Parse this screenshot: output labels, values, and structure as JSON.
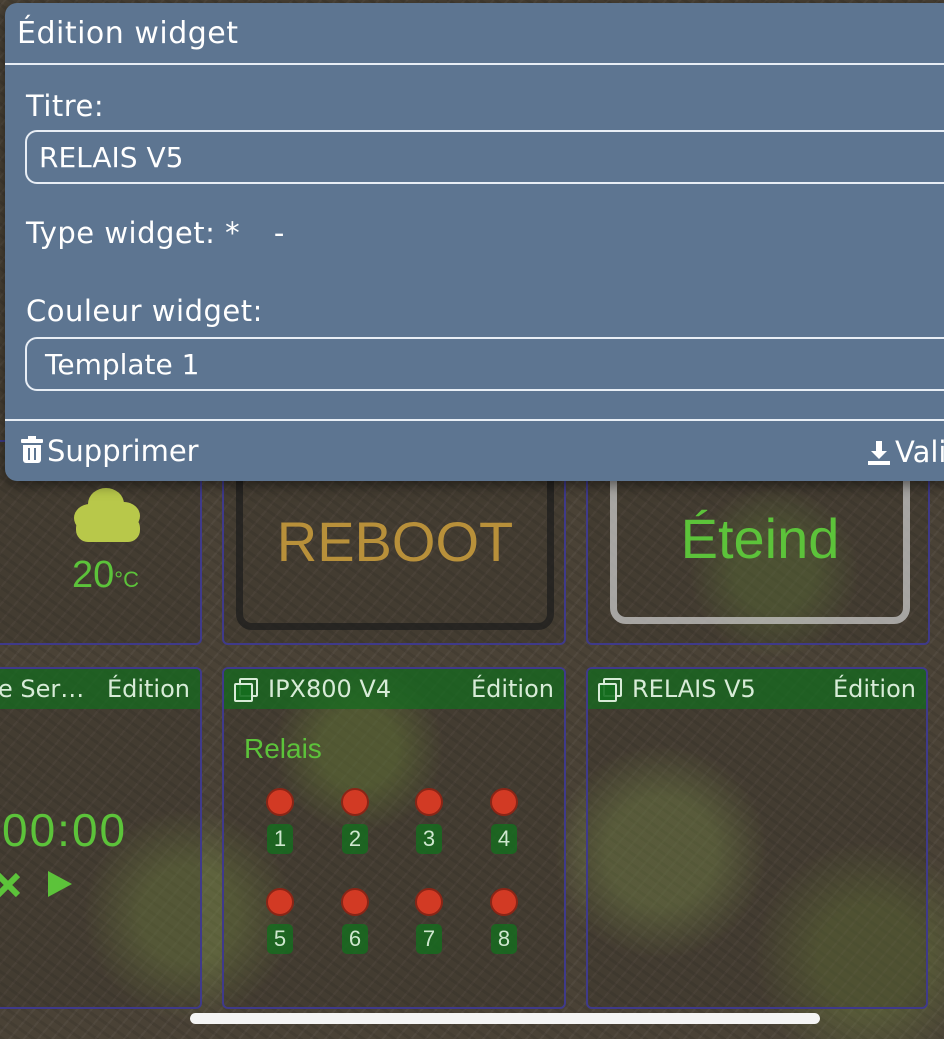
{
  "modal": {
    "title": "Édition widget",
    "titre_label": "Titre:",
    "titre_value": "RELAIS V5",
    "type_label": "Type widget: *",
    "type_value": "-",
    "couleur_label": "Couleur widget:",
    "couleur_value": "Template 1",
    "delete_label": "Supprimer",
    "validate_label": "Vali"
  },
  "weather": {
    "temperature": "20",
    "unit": "°C",
    "icon": "cloud-icon"
  },
  "buttons": {
    "reboot_label": "REBOOT",
    "eteind_label": "Éteind"
  },
  "tiles": {
    "timer": {
      "title": "e Servi...",
      "edit_label": "Édition",
      "time": "00:00"
    },
    "ipx800": {
      "title": "IPX800 V4",
      "edit_label": "Édition",
      "section_label": "Relais",
      "relays": [
        "1",
        "2",
        "3",
        "4",
        "5",
        "6",
        "7",
        "8"
      ]
    },
    "relais": {
      "title": "RELAIS V5",
      "edit_label": "Édition"
    }
  },
  "colors": {
    "modal_bg": "#5d7591",
    "header_green": "#146e1e",
    "reboot_text": "#b8903a",
    "eteind_text": "#5cc33a",
    "relay_red": "#d23a24",
    "label_green": "#5cc33a"
  }
}
